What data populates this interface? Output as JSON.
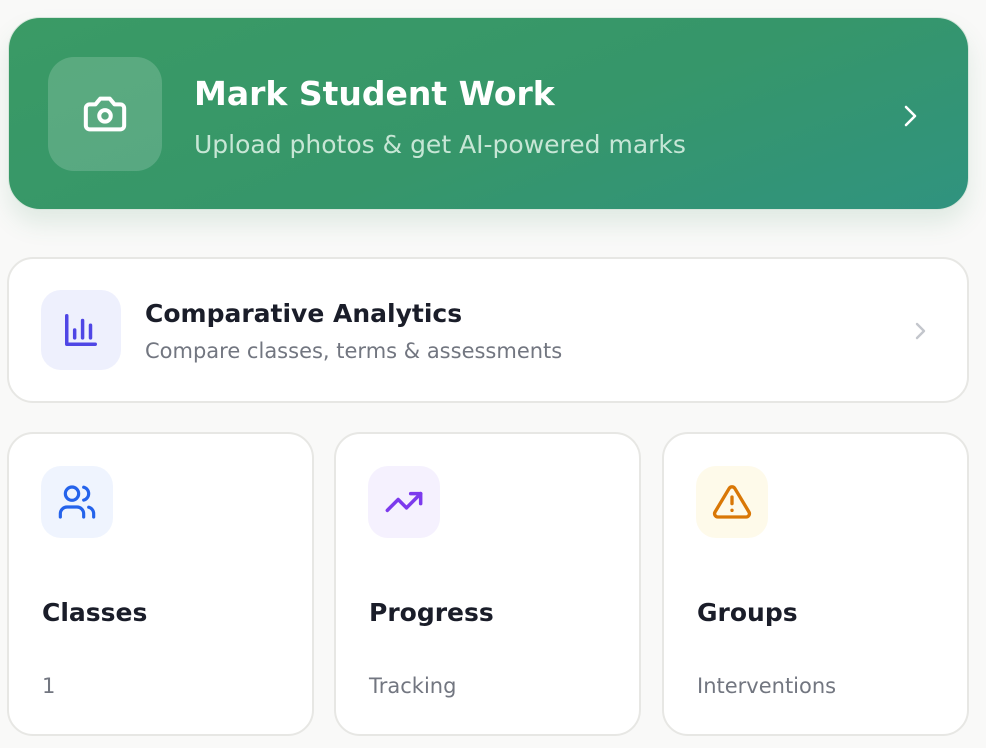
{
  "hero": {
    "title": "Mark Student Work",
    "subtitle": "Upload photos & get AI-powered marks",
    "icon": "camera-icon",
    "chevron_icon": "chevron-right-icon",
    "gradient_start": "#3a9a65",
    "gradient_end": "#30937f",
    "text_color": "#ffffff"
  },
  "analytics": {
    "title": "Comparative Analytics",
    "subtitle": "Compare classes, terms & assessments",
    "icon": "bar-chart-icon",
    "icon_color": "#4f46e5",
    "icon_bg": "#eef0fd",
    "chevron_icon": "chevron-right-icon"
  },
  "tiles": [
    {
      "title": "Classes",
      "subtitle": "1",
      "icon": "users-icon",
      "icon_color": "#2563eb",
      "icon_bg": "#eff4fe"
    },
    {
      "title": "Progress",
      "subtitle": "Tracking",
      "icon": "trending-up-icon",
      "icon_color": "#7c3aed",
      "icon_bg": "#f5f1fe"
    },
    {
      "title": "Groups",
      "subtitle": "Interventions",
      "icon": "warning-icon",
      "icon_color": "#d97706",
      "icon_bg": "#fefaea"
    }
  ],
  "colors": {
    "page_background": "#f9f9f8",
    "card_background": "#ffffff",
    "card_border": "#e7e7e4",
    "heading_text": "#1a1d29",
    "muted_text": "#727680"
  }
}
